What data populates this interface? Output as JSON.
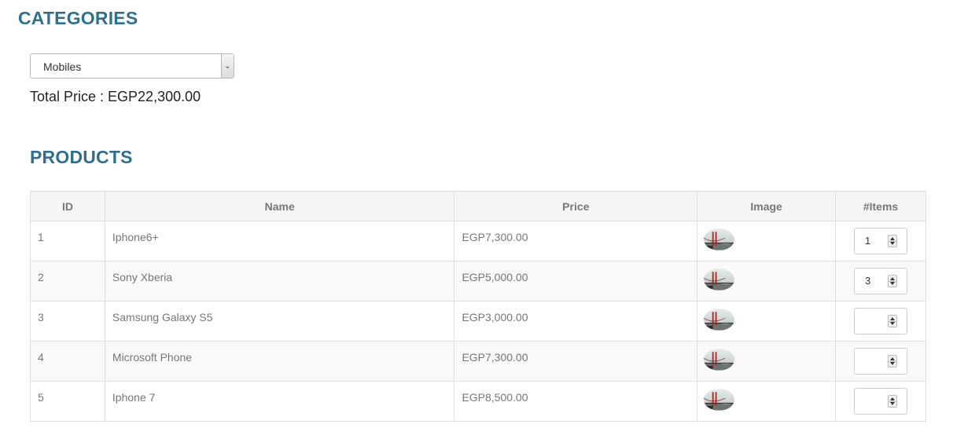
{
  "categories": {
    "heading": "CATEGORIES",
    "selected": "Mobiles"
  },
  "total": {
    "text": "Total Price : EGP22,300.00"
  },
  "products": {
    "heading": "PRODUCTS",
    "columns": [
      "ID",
      "Name",
      "Price",
      "Image",
      "#Items"
    ],
    "rows": [
      {
        "id": "1",
        "name": "Iphone6+",
        "price": "EGP7,300.00",
        "image": "golden-gate-thumbnail",
        "items": "1"
      },
      {
        "id": "2",
        "name": "Sony Xberia",
        "price": "EGP5,000.00",
        "image": "golden-gate-thumbnail",
        "items": "3"
      },
      {
        "id": "3",
        "name": "Samsung Galaxy S5",
        "price": "EGP3,000.00",
        "image": "golden-gate-thumbnail",
        "items": ""
      },
      {
        "id": "4",
        "name": "Microsoft Phone",
        "price": "EGP7,300.00",
        "image": "golden-gate-thumbnail",
        "items": ""
      },
      {
        "id": "5",
        "name": "Iphone 7",
        "price": "EGP8,500.00",
        "image": "golden-gate-thumbnail",
        "items": ""
      }
    ]
  },
  "colors": {
    "heading": "#30708f",
    "table_border": "#dddddd",
    "header_bg": "#f5f5f5",
    "cell_text": "#777777"
  }
}
